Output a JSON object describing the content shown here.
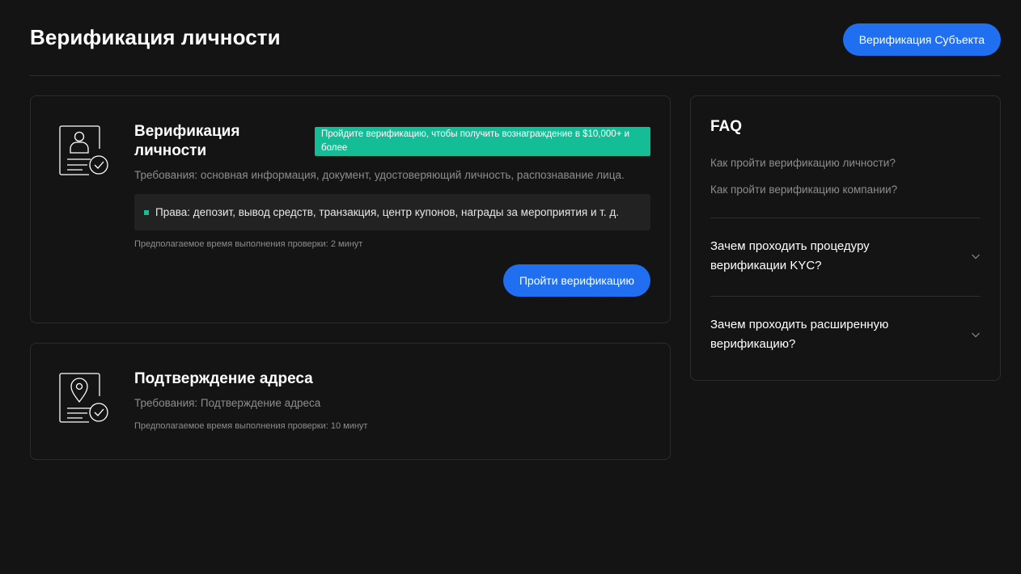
{
  "header": {
    "title": "Верификация личности",
    "entity_button": "Верификация Субъекта"
  },
  "identity_card": {
    "icon": "id-card-check-icon",
    "title": "Верификация личности",
    "badge": "Пройдите верификацию, чтобы получить вознаграждение в $10,000+ и более",
    "requirements": "Требования: основная информация, документ, удостоверяющий личность, распознавание лица.",
    "rights": "Права: депозит, вывод средств, транзакция, центр купонов, награды за мероприятия и т. д.",
    "eta": "Предполагаемое время выполнения проверки: 2 минут",
    "button": "Пройти верификацию"
  },
  "address_card": {
    "icon": "location-document-check-icon",
    "title": "Подтверждение адреса",
    "requirements": "Требования: Подтверждение адреса",
    "eta": "Предполагаемое время выполнения проверки: 10 минут"
  },
  "faq": {
    "title": "FAQ",
    "links": [
      "Как пройти верификацию личности?",
      "Как пройти верификацию компании?"
    ],
    "items": [
      {
        "question": "Зачем проходить процедуру верификации KYC?"
      },
      {
        "question": "Зачем проходить расширенную верификацию?"
      }
    ]
  },
  "colors": {
    "background": "#141414",
    "accent_blue": "#1f6ff0",
    "accent_green": "#14bd96",
    "muted_text": "#8d8d8d"
  }
}
